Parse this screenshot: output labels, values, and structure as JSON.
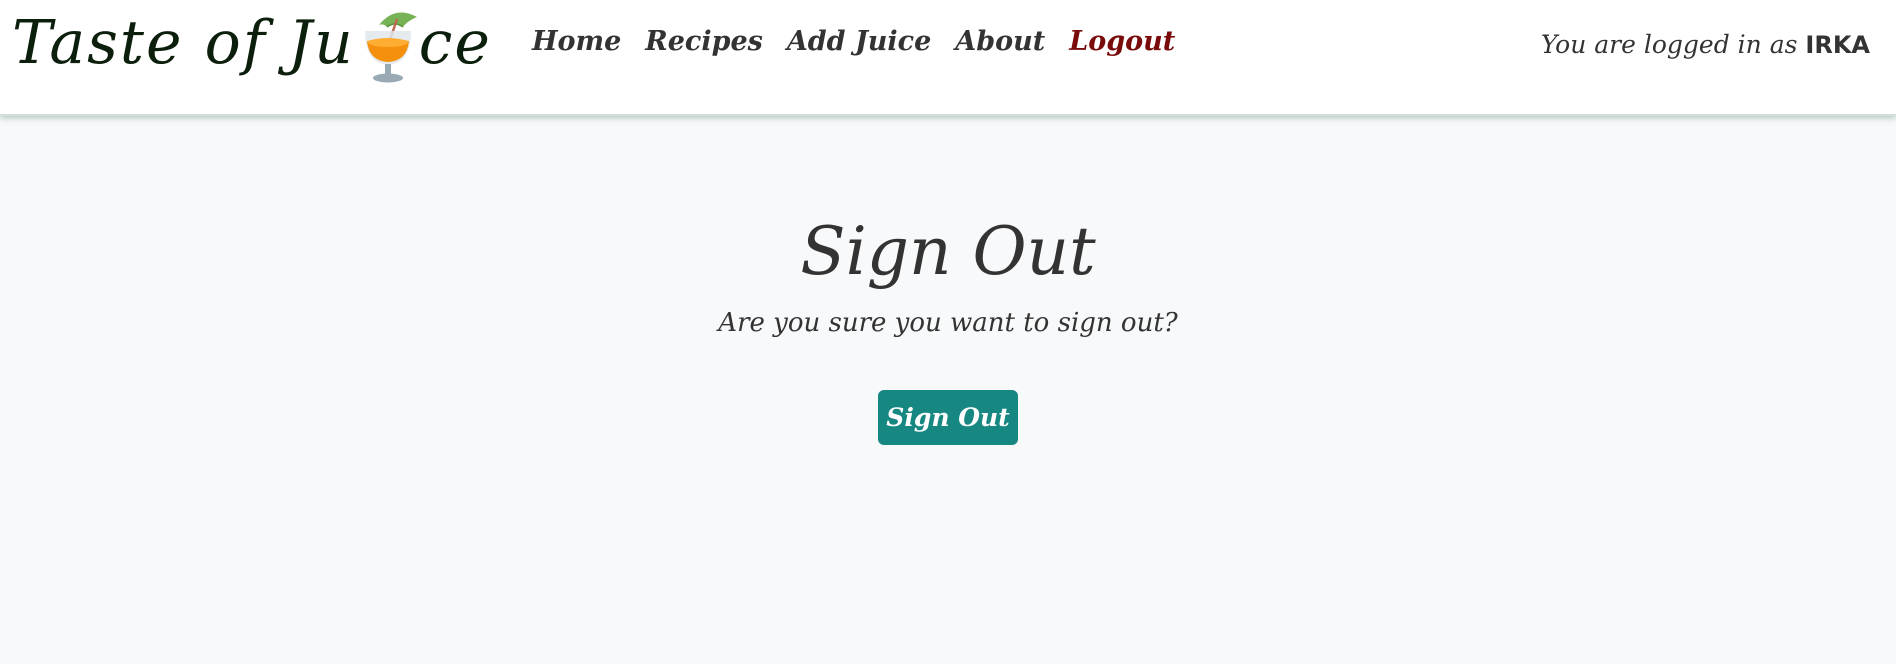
{
  "brand": {
    "text_before": "Taste of Ju",
    "text_after": "ce",
    "icon": "tropical-drink-icon"
  },
  "nav": {
    "items": [
      {
        "label": "Home"
      },
      {
        "label": "Recipes"
      },
      {
        "label": "Add Juice"
      },
      {
        "label": "About"
      },
      {
        "label": "Logout"
      }
    ]
  },
  "user_status": {
    "prefix": "You are logged in as ",
    "username": "IRKA"
  },
  "main": {
    "title": "Sign Out",
    "subtitle": "Are you sure you want to sign out?",
    "button_label": "Sign Out"
  },
  "colors": {
    "accent": "#178781",
    "logout": "#7a0b0b",
    "brand_text": "#0c1f0c",
    "background": "#f8f9fa"
  }
}
